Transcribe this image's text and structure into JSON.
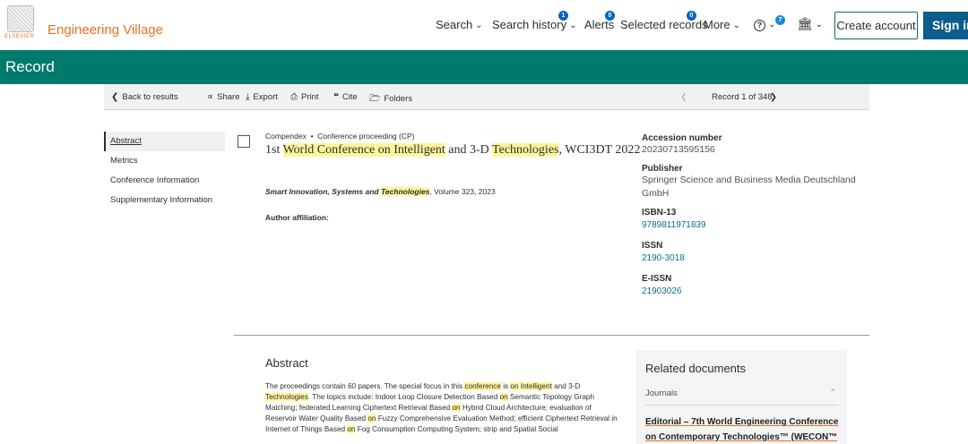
{
  "brand": {
    "logo_text": "ELSEVIER",
    "name": "Engineering Village"
  },
  "nav": {
    "search": "Search",
    "search_history": "Search history",
    "search_history_count": "1",
    "alerts": "Alerts",
    "alerts_count": "0",
    "selected_records": "Selected records",
    "selected_count": "0",
    "more": "More",
    "help_count": "7",
    "create_account": "Create account",
    "sign_in": "Sign in"
  },
  "band": {
    "title": "Record"
  },
  "toolbar": {
    "back": "Back to results",
    "share": "Share",
    "export": "Export",
    "print": "Print",
    "cite": "Cite",
    "folders": "Folders",
    "record_position": "Record 1 of 348"
  },
  "sidebar": {
    "items": [
      {
        "label": "Abstract",
        "active": true
      },
      {
        "label": "Metrics"
      },
      {
        "label": "Conference Information"
      },
      {
        "label": "Supplementary Information"
      }
    ]
  },
  "record": {
    "database": "Compendex",
    "doc_type": "Conference proceeding (CP)",
    "title_parts": [
      "1st ",
      "World Conference on Intelligent",
      " and 3-D ",
      "Technologies",
      ", WCI3DT 2022"
    ],
    "source_parts": [
      "Smart Innovation, Systems and ",
      "Technologies",
      ", Volume 323, 2023"
    ],
    "author_affiliation_label": "Author affiliation:"
  },
  "details": {
    "accession_label": "Accession number",
    "accession_value": "20230713595156",
    "publisher_label": "Publisher",
    "publisher_value": "Springer Science and Business Media Deutschland GmbH",
    "isbn_label": "ISBN-13",
    "isbn_value": "9789811971839",
    "issn_label": "ISSN",
    "issn_value": "2190-3018",
    "eissn_label": "E-ISSN",
    "eissn_value": "21903026"
  },
  "abstract": {
    "heading": "Abstract",
    "parts": [
      "The proceedings contain 60 papers. The special focus in this ",
      "conference",
      " is ",
      "on",
      " ",
      "Intelligent",
      " and 3-D ",
      "Technologies",
      ". The topics include: Indoor Loop Closure Detection Based ",
      "on",
      " Semantic Topology Graph Matching; federated Learning Ciphertext Retrieval Based ",
      "on",
      " Hybrid Cloud Architecture; evaluation of Reservoir Water Quality Based ",
      "on",
      " Fuzzy Comprehensive Evaluation Method; efficient Ciphertext Retrieval in Internet of Things Based ",
      "on",
      " Fog Consumption Computing System; strip and Spatial Social"
    ]
  },
  "related": {
    "heading": "Related documents",
    "section": "Journals",
    "link": "Editorial – 7th World Engineering Conference on Contemporary Technologies™ (WECON™"
  }
}
